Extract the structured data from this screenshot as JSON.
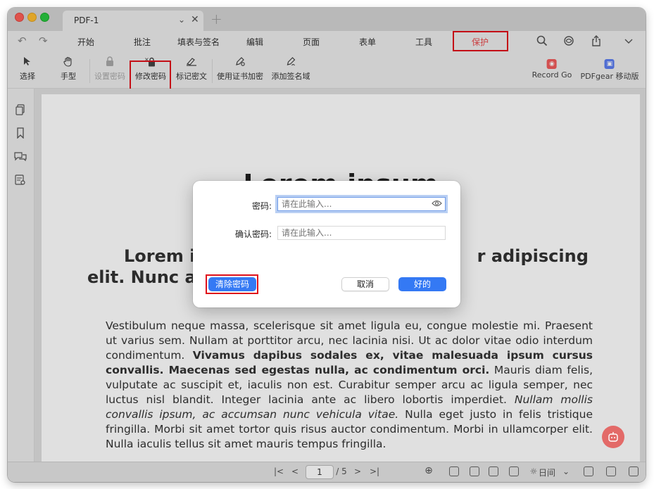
{
  "window": {
    "tab_title": "PDF-1",
    "tab_chevron": "⌄",
    "tab_close": "✕",
    "tab_add": "+"
  },
  "menu": {
    "undo_icon": "↶",
    "redo_icon": "↷",
    "items": [
      "开始",
      "批注",
      "填表与签名",
      "编辑",
      "页面",
      "表单",
      "工具",
      "保护"
    ],
    "active_item": "保护",
    "search_icon": "⌕",
    "icons": [
      "search-icon",
      "ai-assistant-icon",
      "share-icon",
      "chevron-down-icon"
    ]
  },
  "toolbar": {
    "tools": [
      {
        "label": "选择",
        "icon": "➤"
      },
      {
        "label": "手型",
        "icon": "✋"
      },
      {
        "label": "设置密码",
        "icon": "🔒"
      },
      {
        "label": "修改密码",
        "icon": "🔒"
      },
      {
        "label": "标记密文",
        "icon": "✎"
      },
      {
        "label": "使用证书加密",
        "icon": "✒"
      },
      {
        "label": "添加签名域",
        "icon": "✒"
      }
    ],
    "record_label": "Record Go",
    "pdfgear_label": "PDFgear 移动版",
    "record_icon": "◉",
    "pdfgear_icon": "▣"
  },
  "document": {
    "heading": "Lorem ipsum",
    "subheading": "Lorem ipsum dolor sit amet, consectetur adipiscing elit. Nunc ac faucibus odio.",
    "subheading_left": "Lorem ip",
    "subheading_left2": "elit. Nunc a",
    "subheading_right": "r adipiscing",
    "body_1": "Vestibulum neque massa, scelerisque sit amet ligula eu, congue molestie mi. Praesent ut varius sem. Nullam at porttitor arcu, nec lacinia nisi. Ut ac dolor vitae odio interdum condimentum. ",
    "body_bold": "Vivamus dapibus sodales ex, vitae malesuada ipsum cursus convallis. Maecenas sed egestas nulla, ac condimentum orci.",
    "body_2": " Mauris diam felis, vulputate ac suscipit et, iaculis non est. Curabitur semper arcu ac ligula semper, nec luctus nisl blandit. Integer lacinia ante ac libero lobortis imperdiet. ",
    "body_italic": "Nullam mollis convallis ipsum, ac accumsan nunc vehicula vitae.",
    "body_3": " Nulla eget justo in felis tristique fringilla. Morbi sit amet tortor quis risus auctor condimentum. Morbi in ullamcorper elit. Nulla iaculis tellus sit amet mauris tempus fringilla."
  },
  "dialog": {
    "password_label": "密码:",
    "password_placeholder": "请在此输入...",
    "confirm_label": "确认密码:",
    "confirm_placeholder": "请在此输入...",
    "clear_button": "清除密码",
    "cancel_button": "取消",
    "ok_button": "好的",
    "eye_icon": "◉"
  },
  "statusbar": {
    "first_page": "|<",
    "prev_page": "<",
    "current_page": "1",
    "total_pages": "/ 5",
    "next_page": ">",
    "last_page": ">|",
    "zoom_icon": "⊕",
    "theme_label": "日间",
    "theme_icon": "☼",
    "theme_chevron": "⌄"
  },
  "highlight_color": "#e0101a",
  "accent_color": "#3479f4"
}
